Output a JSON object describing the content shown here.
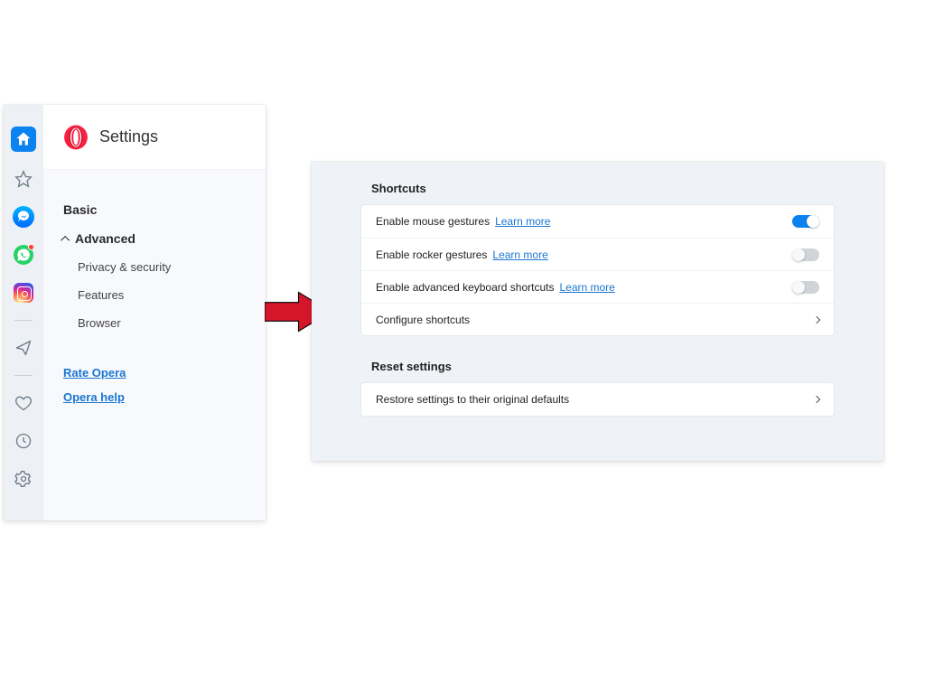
{
  "sidebar": {
    "icons": [
      {
        "name": "home",
        "semantic": "home-icon"
      },
      {
        "name": "speed-dial",
        "semantic": "star-outline-icon"
      },
      {
        "name": "messenger",
        "semantic": "messenger-icon"
      },
      {
        "name": "whatsapp",
        "semantic": "whatsapp-icon"
      },
      {
        "name": "instagram",
        "semantic": "instagram-icon"
      },
      {
        "name": "send",
        "semantic": "paper-plane-icon"
      },
      {
        "name": "heart",
        "semantic": "heart-outline-icon"
      },
      {
        "name": "history",
        "semantic": "clock-icon"
      },
      {
        "name": "settings",
        "semantic": "gear-icon"
      }
    ]
  },
  "settings_header": {
    "title": "Settings",
    "logo": "opera-logo"
  },
  "nav": {
    "basic": "Basic",
    "advanced": "Advanced",
    "subs": [
      "Privacy & security",
      "Features",
      "Browser"
    ],
    "links": [
      {
        "label": "Rate Opera"
      },
      {
        "label": "Opera help"
      }
    ]
  },
  "detail": {
    "section1": {
      "heading": "Shortcuts",
      "rows": [
        {
          "label": "Enable mouse gestures",
          "learn_more": "Learn more",
          "toggle": "on"
        },
        {
          "label": "Enable rocker gestures",
          "learn_more": "Learn more",
          "toggle": "off"
        },
        {
          "label": "Enable advanced keyboard shortcuts",
          "learn_more": "Learn more",
          "toggle": "off"
        },
        {
          "label": "Configure shortcuts",
          "type": "nav"
        }
      ]
    },
    "section2": {
      "heading": "Reset settings",
      "rows": [
        {
          "label": "Restore settings to their original defaults",
          "type": "nav"
        }
      ]
    }
  },
  "colors": {
    "accent": "#0a82f0",
    "link": "#1a76d2"
  }
}
